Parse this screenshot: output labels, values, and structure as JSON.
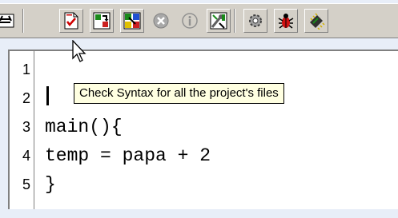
{
  "toolbar": {
    "buttons": [
      {
        "name": "compile-icon"
      },
      {
        "name": "check-syntax-icon"
      },
      {
        "name": "build-icon"
      },
      {
        "name": "build-all-icon"
      },
      {
        "name": "stop-icon"
      },
      {
        "name": "info-icon"
      },
      {
        "name": "tools-icon"
      },
      {
        "name": "settings-icon"
      },
      {
        "name": "debug-icon"
      },
      {
        "name": "chip-icon"
      }
    ]
  },
  "tooltip": {
    "text": "Check Syntax for all the project's files"
  },
  "editor": {
    "line_numbers": [
      "1",
      "2",
      "3",
      "4",
      "5"
    ],
    "lines": [
      "",
      "",
      "main(){",
      "temp = papa + 2",
      "}"
    ]
  },
  "colors": {
    "tooltip_bg": "#ffffe1",
    "toolbar_bg": "#d4d0c8",
    "page_bg": "#e8eef8"
  }
}
